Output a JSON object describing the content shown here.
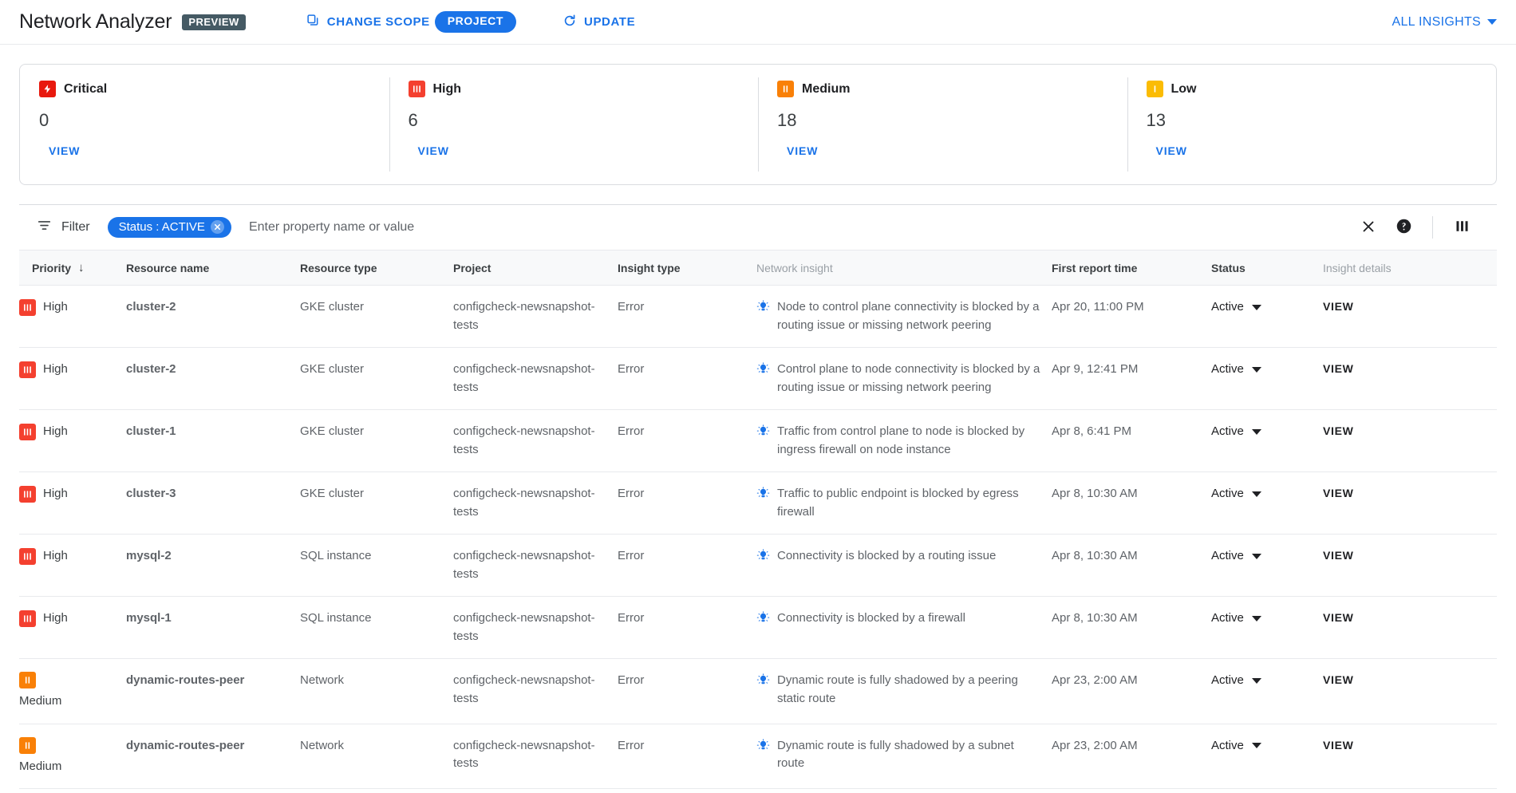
{
  "header": {
    "title": "Network Analyzer",
    "preview_badge": "PREVIEW",
    "change_scope_label": "CHANGE SCOPE",
    "scope_value": "PROJECT",
    "update_label": "UPDATE",
    "all_insights_label": "ALL INSIGHTS",
    "accent_color": "#1a73e8"
  },
  "summary_cards": [
    {
      "label": "Critical",
      "count": "0",
      "view_label": "VIEW",
      "icon": "critical-bolt-icon",
      "color": "#e8190e"
    },
    {
      "label": "High",
      "count": "6",
      "view_label": "VIEW",
      "icon": "high-bars-icon",
      "color": "#f4402f"
    },
    {
      "label": "Medium",
      "count": "18",
      "view_label": "VIEW",
      "icon": "medium-bars-icon",
      "color": "#f98007"
    },
    {
      "label": "Low",
      "count": "13",
      "view_label": "VIEW",
      "icon": "low-bar-icon",
      "color": "#fbbc04"
    }
  ],
  "filter_bar": {
    "label": "Filter",
    "chip": "Status : ACTIVE",
    "placeholder": "Enter property name or value",
    "clear_icon": "close-icon",
    "help_icon": "help-icon",
    "columns_icon": "column-settings-icon"
  },
  "table": {
    "columns": [
      {
        "key": "priority",
        "label": "Priority",
        "dim": false,
        "sorted": true
      },
      {
        "key": "resource",
        "label": "Resource name",
        "dim": false,
        "sorted": false
      },
      {
        "key": "rtype",
        "label": "Resource type",
        "dim": false,
        "sorted": false
      },
      {
        "key": "project",
        "label": "Project",
        "dim": false,
        "sorted": false
      },
      {
        "key": "itype",
        "label": "Insight type",
        "dim": false,
        "sorted": false
      },
      {
        "key": "insight",
        "label": "Network insight",
        "dim": true,
        "sorted": false
      },
      {
        "key": "time",
        "label": "First report time",
        "dim": false,
        "sorted": false
      },
      {
        "key": "status",
        "label": "Status",
        "dim": false,
        "sorted": false
      },
      {
        "key": "details",
        "label": "Insight details",
        "dim": true,
        "sorted": false
      }
    ],
    "sort_indicator": "↓",
    "rows": [
      {
        "priority": "High",
        "priority_level": "high",
        "resource": "cluster-2",
        "rtype": "GKE cluster",
        "project": "configcheck-newsnapshot-tests",
        "itype": "Error",
        "insight": "Node to control plane connectivity is blocked by a routing issue or missing network peering",
        "time": "Apr 20, 11:00 PM",
        "status": "Active",
        "details": "VIEW"
      },
      {
        "priority": "High",
        "priority_level": "high",
        "resource": "cluster-2",
        "rtype": "GKE cluster",
        "project": "configcheck-newsnapshot-tests",
        "itype": "Error",
        "insight": "Control plane to node connectivity is blocked by a routing issue or missing network peering",
        "time": "Apr 9, 12:41 PM",
        "status": "Active",
        "details": "VIEW"
      },
      {
        "priority": "High",
        "priority_level": "high",
        "resource": "cluster-1",
        "rtype": "GKE cluster",
        "project": "configcheck-newsnapshot-tests",
        "itype": "Error",
        "insight": "Traffic from control plane to node is blocked by ingress firewall on node instance",
        "time": "Apr 8, 6:41 PM",
        "status": "Active",
        "details": "VIEW"
      },
      {
        "priority": "High",
        "priority_level": "high",
        "resource": "cluster-3",
        "rtype": "GKE cluster",
        "project": "configcheck-newsnapshot-tests",
        "itype": "Error",
        "insight": "Traffic to public endpoint is blocked by egress firewall",
        "time": "Apr 8, 10:30 AM",
        "status": "Active",
        "details": "VIEW"
      },
      {
        "priority": "High",
        "priority_level": "high",
        "resource": "mysql-2",
        "rtype": "SQL instance",
        "project": "configcheck-newsnapshot-tests",
        "itype": "Error",
        "insight": "Connectivity is blocked by a routing issue",
        "time": "Apr 8, 10:30 AM",
        "status": "Active",
        "details": "VIEW"
      },
      {
        "priority": "High",
        "priority_level": "high",
        "resource": "mysql-1",
        "rtype": "SQL instance",
        "project": "configcheck-newsnapshot-tests",
        "itype": "Error",
        "insight": "Connectivity is blocked by a firewall",
        "time": "Apr 8, 10:30 AM",
        "status": "Active",
        "details": "VIEW"
      },
      {
        "priority": "Medium",
        "priority_level": "medium",
        "resource": "dynamic-routes-peer",
        "rtype": "Network",
        "project": "configcheck-newsnapshot-tests",
        "itype": "Error",
        "insight": "Dynamic route is fully shadowed by a peering static route",
        "time": "Apr 23, 2:00 AM",
        "status": "Active",
        "details": "VIEW"
      },
      {
        "priority": "Medium",
        "priority_level": "medium",
        "resource": "dynamic-routes-peer",
        "rtype": "Network",
        "project": "configcheck-newsnapshot-tests",
        "itype": "Error",
        "insight": "Dynamic route is fully shadowed by a subnet route",
        "time": "Apr 23, 2:00 AM",
        "status": "Active",
        "details": "VIEW"
      }
    ]
  }
}
